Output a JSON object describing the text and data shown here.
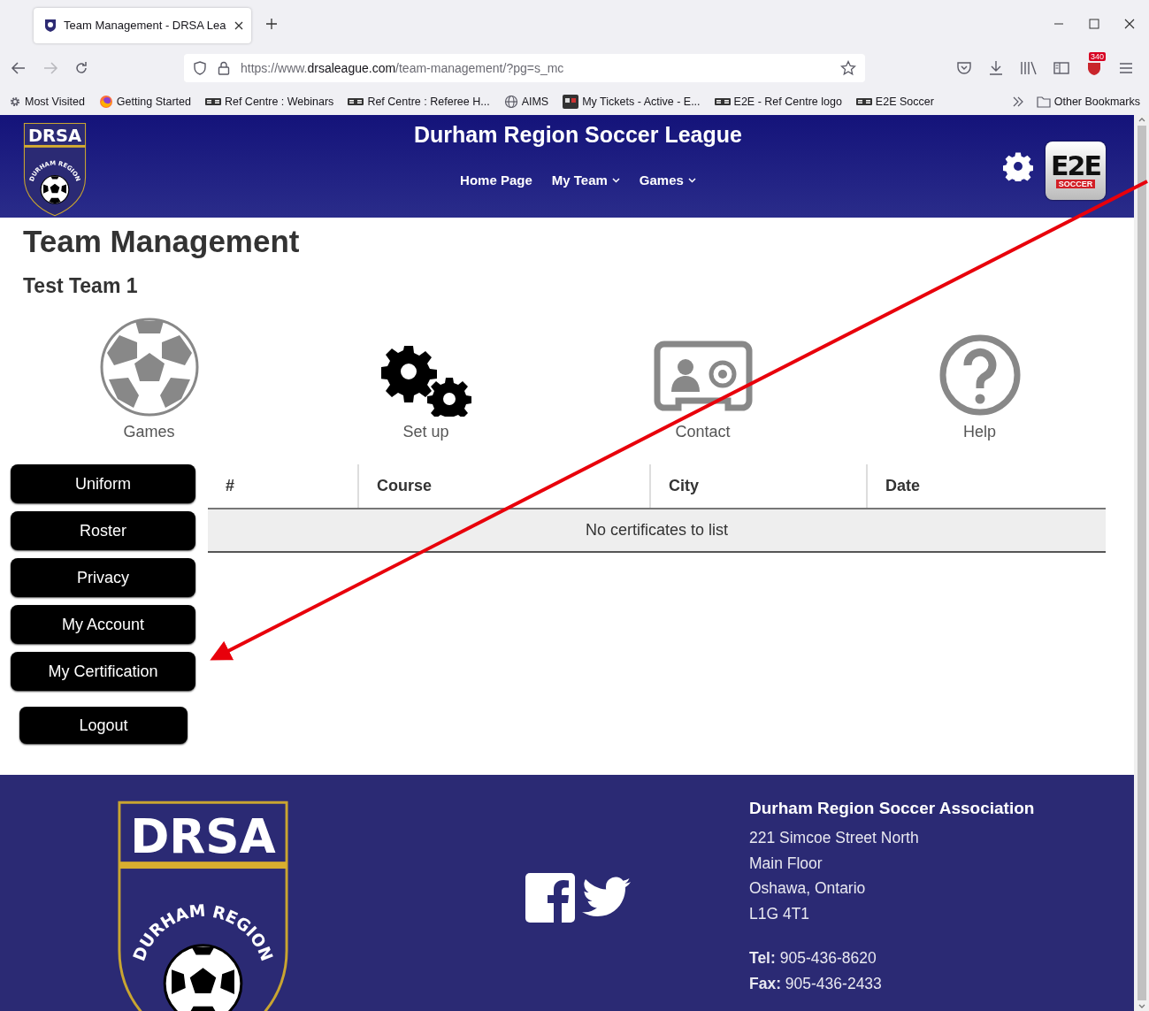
{
  "browser": {
    "tab": {
      "title": "Team Management - DRSA Lea",
      "selected": true
    },
    "url": {
      "prefix": "https://www.",
      "domain": "drsaleague.com",
      "path": "/team-management/?pg=s_mc"
    },
    "extension_badge": "340",
    "bookmarks": [
      {
        "label": "Most Visited",
        "kind": "gear"
      },
      {
        "label": "Getting Started",
        "kind": "firefox"
      },
      {
        "label": "Ref Centre : Webinars",
        "kind": "e2e"
      },
      {
        "label": "Ref Centre : Referee H...",
        "kind": "e2e"
      },
      {
        "label": "AIMS",
        "kind": "globe"
      },
      {
        "label": "My Tickets - Active - E...",
        "kind": "tickets"
      },
      {
        "label": "E2E - Ref Centre logo",
        "kind": "e2e"
      },
      {
        "label": "E2E Soccer",
        "kind": "e2e"
      }
    ],
    "other_bookmarks": "Other Bookmarks"
  },
  "header": {
    "logo": {
      "abbr": "DRSA",
      "top_arc": "DURHAM REGION"
    },
    "title": "Durham Region Soccer League",
    "nav": [
      {
        "label": "Home Page",
        "dropdown": false
      },
      {
        "label": "My Team",
        "dropdown": true
      },
      {
        "label": "Games",
        "dropdown": true
      }
    ],
    "e2e_logo": {
      "mark": "E2E",
      "sub": "SOCCER"
    }
  },
  "page": {
    "title": "Team Management",
    "team": "Test Team 1",
    "tiles": [
      {
        "label": "Games",
        "kind": "ball"
      },
      {
        "label": "Set up",
        "kind": "gears"
      },
      {
        "label": "Contact",
        "kind": "contact"
      },
      {
        "label": "Help",
        "kind": "help"
      }
    ],
    "menu": [
      {
        "label": "Uniform",
        "kind": "link"
      },
      {
        "label": "Roster",
        "kind": "link"
      },
      {
        "label": "Privacy",
        "kind": "link"
      },
      {
        "label": "My Account",
        "kind": "link"
      },
      {
        "label": "My Certification",
        "kind": "link"
      },
      {
        "label": "Logout",
        "kind": "logout"
      }
    ],
    "table": {
      "columns": [
        "#",
        "Course",
        "City",
        "Date"
      ],
      "empty": "No certificates to list"
    }
  },
  "footer": {
    "logo": {
      "abbr": "DRSA",
      "top_arc": "DURHAM REGION"
    },
    "name": "Durham Region Soccer Association",
    "address": [
      "221 Simcoe Street North",
      "Main Floor",
      "Oshawa, Ontario",
      "L1G 4T1"
    ],
    "phones": [
      "**Tel:** 905-436-8620",
      "**Fax:** 905-436-2433"
    ]
  }
}
